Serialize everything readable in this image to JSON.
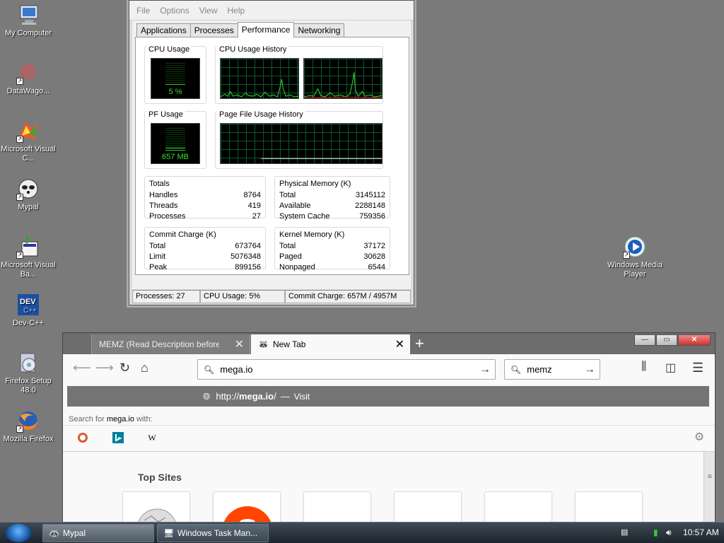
{
  "desktop": {
    "icons": [
      {
        "label": "My Computer",
        "icon": "computer-icon"
      },
      {
        "label": "DataWago...",
        "icon": "datawagon-icon"
      },
      {
        "label": "Microsoft Visual C...",
        "icon": "visual-cpp-icon"
      },
      {
        "label": "Mypal",
        "icon": "mypal-icon"
      },
      {
        "label": "Microsoft Visual Ba...",
        "icon": "visual-basic-icon"
      },
      {
        "label": "Dev-C++",
        "icon": "devcpp-icon"
      },
      {
        "label": "Firefox Setup 48.0",
        "icon": "firefox-setup-icon"
      },
      {
        "label": "Mozilla Firefox",
        "icon": "firefox-icon"
      },
      {
        "label": "Windows Media Player",
        "icon": "media-player-icon"
      }
    ]
  },
  "taskmgr": {
    "menu": [
      "File",
      "Options",
      "View",
      "Help"
    ],
    "tabs": [
      "Applications",
      "Processes",
      "Performance",
      "Networking"
    ],
    "active_tab": "Performance",
    "cpu_usage": {
      "title": "CPU Usage",
      "value": "5 %",
      "fraction": 0.05
    },
    "cpu_history_title": "CPU Usage History",
    "pf_usage": {
      "title": "PF Usage",
      "value": "657 MB",
      "fraction": 0.13
    },
    "pf_history_title": "Page File Usage History",
    "totals": {
      "title": "Totals",
      "rows": [
        [
          "Handles",
          "8764"
        ],
        [
          "Threads",
          "419"
        ],
        [
          "Processes",
          "27"
        ]
      ]
    },
    "physical": {
      "title": "Physical Memory (K)",
      "rows": [
        [
          "Total",
          "3145112"
        ],
        [
          "Available",
          "2288148"
        ],
        [
          "System Cache",
          "759356"
        ]
      ]
    },
    "commit": {
      "title": "Commit Charge (K)",
      "rows": [
        [
          "Total",
          "673764"
        ],
        [
          "Limit",
          "5076348"
        ],
        [
          "Peak",
          "899156"
        ]
      ]
    },
    "kernel": {
      "title": "Kernel Memory (K)",
      "rows": [
        [
          "Total",
          "37172"
        ],
        [
          "Paged",
          "30628"
        ],
        [
          "Nonpaged",
          "6544"
        ]
      ]
    },
    "status": {
      "processes": "Processes: 27",
      "cpu": "CPU Usage: 5%",
      "commit": "Commit Charge: 657M / 4957M"
    }
  },
  "firefox": {
    "tabs": [
      {
        "title": "MEMZ (Read Description before",
        "active": false
      },
      {
        "title": "New Tab",
        "active": true
      }
    ],
    "url_value": "mega.io",
    "search_value": "memz",
    "suggestion": {
      "prefix": "http://",
      "bold": "mega.io",
      "suffix": "/",
      "sep": "—",
      "action": "Visit"
    },
    "search_for": {
      "label": "Search for",
      "term": "mega.io",
      "suffix": "with:"
    },
    "engines": [
      "duckduckgo-icon",
      "bing-icon",
      "wikipedia-icon"
    ],
    "wiki_glyph": "W",
    "top_sites_title": "Top Sites"
  },
  "taskbar": {
    "buttons": [
      {
        "label": "Mypal",
        "active": true
      },
      {
        "label": "Windows Task Man...",
        "active": false
      }
    ],
    "clock": "10:57 AM"
  }
}
